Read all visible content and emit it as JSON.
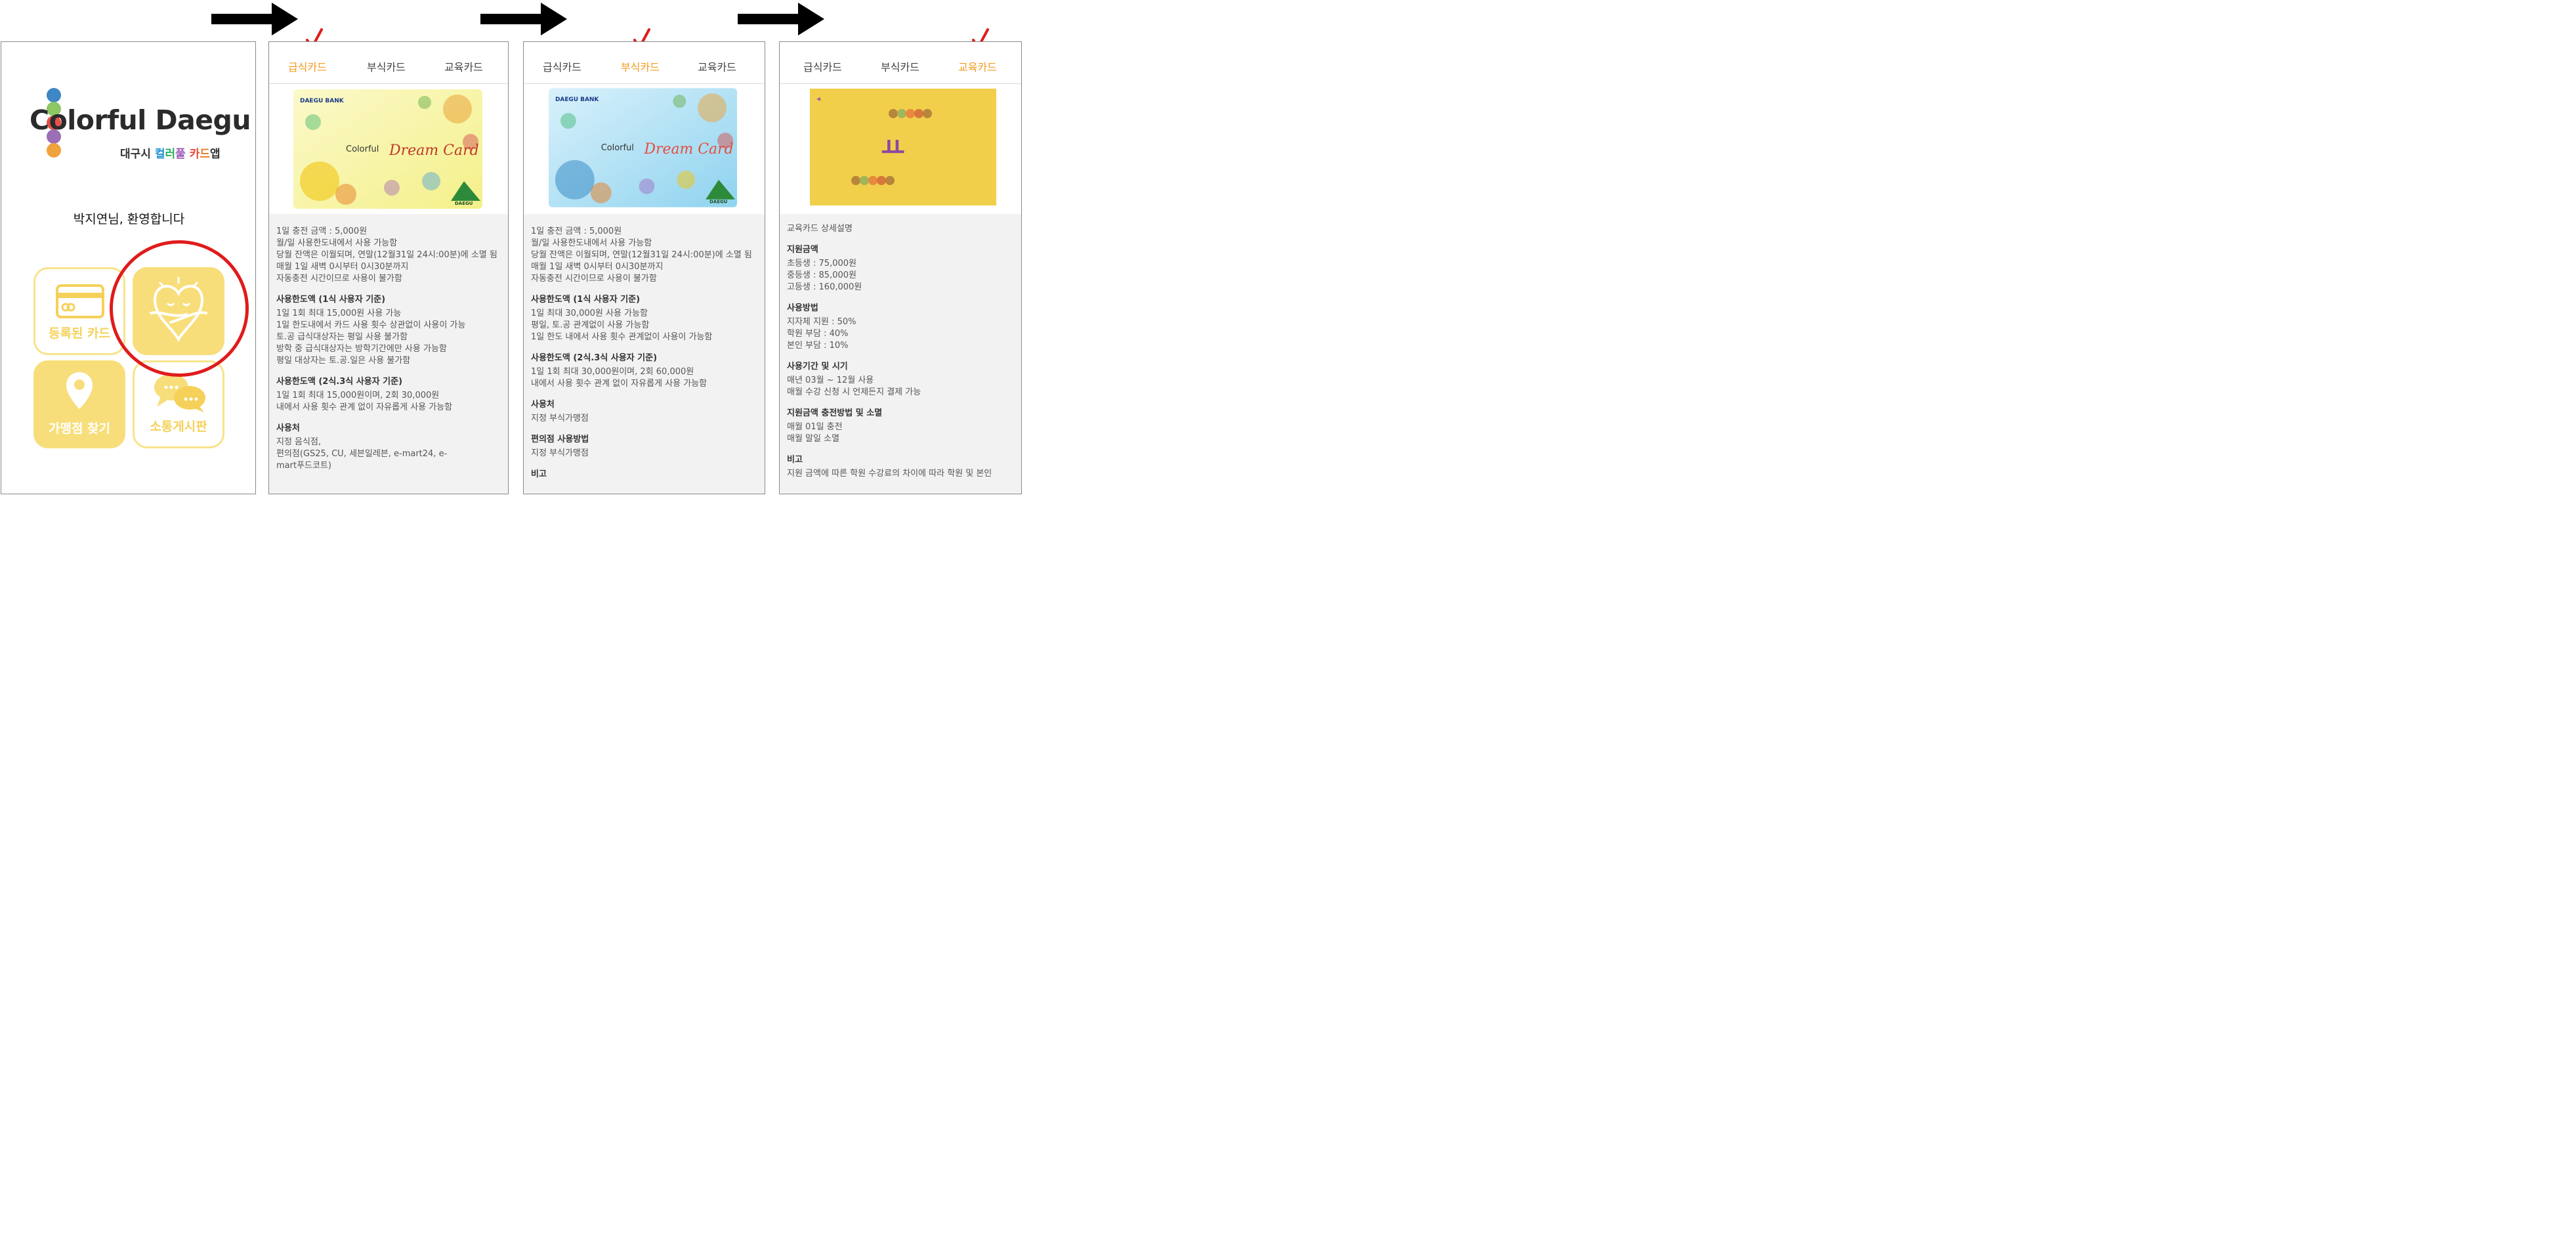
{
  "colors": {
    "accent": "#f39a1e",
    "tile_yellow": "#f8de7a",
    "highlight_red": "#e01b1b",
    "check_red": "#e01b1b"
  },
  "home": {
    "logo_text": "Colorful Daegu",
    "logo_sub": {
      "p1": "대구시 ",
      "p2": "컬",
      "p3": "러",
      "p4": "풀 ",
      "p5": "카",
      "p6": "드",
      "p7": "앱"
    },
    "welcome": "박지연님, 환영합니다",
    "tiles": {
      "registered_card": "등록된 카드",
      "card_info": "",
      "store_finder": "가맹점 찾기",
      "board": "소통게시판"
    }
  },
  "tabs": [
    "급식카드",
    "부식카드",
    "교육카드"
  ],
  "screens": {
    "meal": {
      "card": {
        "bank": "DAEGU BANK",
        "brand": "Colorful",
        "title": "Dream Card",
        "corner": "DAEGU"
      },
      "sections": [
        {
          "heading": "",
          "body": "1일 충전 금액 : 5,000원\n월/일 사용한도내에서 사용 가능함\n당월 잔액은 이월되며, 연말(12월31일 24시:00분)에 소멸 됨\n매월 1일 새벽 0시부터 0시30분까지\n자동충전 시간이므로 사용이 불가함"
        },
        {
          "heading": "사용한도액 (1식 사용자 기준)",
          "body": "1일 1회 최대 15,000원 사용 가능\n1일 한도내에서 카드 사용 횟수 상관없이 사용이 가능\n토.공 급식대상자는 평일 사용 불가함\n방학 중 급식대상자는 방학기간에만 사용 가능함\n평일 대상자는 토.공.일은 사용 불가함"
        },
        {
          "heading": "사용한도액 (2식.3식 사용자 기준)",
          "body": "1일 1회 최대 15,000원이며, 2회 30,000원\n내에서 사용 횟수 관계 없이 자유롭게 사용 가능함"
        },
        {
          "heading": "사용처",
          "body": "지정 음식점,\n편의점(GS25, CU, 세븐일레븐, e-mart24, e-\nmart푸드코트)"
        }
      ]
    },
    "side": {
      "card": {
        "bank": "DAEGU BANK",
        "brand": "Colorful",
        "title": "Dream Card",
        "corner": "DAEGU"
      },
      "sections": [
        {
          "heading": "",
          "body": "1일 충전 금액 : 5,000원\n월/일 사용한도내에서 사용 가능함\n당월 잔액은 이월되며, 연말(12월31일 24시:00분)에 소멸 됨\n매월 1일 새벽 0시부터 0시30분까지\n자동충전 시간이므로 사용이 불가함"
        },
        {
          "heading": "사용한도액 (1식 사용자 기준)",
          "body": "1일 최대 30,000원 사용 가능함\n평일, 토.공 관계없이 사용 가능함\n1일 한도 내에서 사용 횟수 관계없이 사용이 가능함"
        },
        {
          "heading": "사용한도액 (2식.3식 사용자 기준)",
          "body": "1일 1회 최대 30,000원이며, 2회 60,000원\n내에서 사용 횟수 관계 없이 자유롭게 사용 가능함"
        },
        {
          "heading": "사용처",
          "body": "지정 부식가맹점"
        },
        {
          "heading": "편의점 사용방법",
          "body": "지정 부식가맹점"
        },
        {
          "heading": "비고",
          "body": ""
        }
      ]
    },
    "edu": {
      "card": {
        "glyph": "ㅛ"
      },
      "sections": [
        {
          "heading": "",
          "body": "교육카드 상세설명"
        },
        {
          "heading": "지원금액",
          "body": "초등생 : 75,000원\n중등생 : 85,000원\n고등생 : 160,000원"
        },
        {
          "heading": "사용방법",
          "body": "지자체 지원 : 50%\n학원 부담 : 40%\n본인 부담 : 10%"
        },
        {
          "heading": "사용기간 및 시기",
          "body": "매년 03월 ~ 12월 사용\n매월 수강 신청 시 언제든지 결제 가능"
        },
        {
          "heading": "지원금액 충전방법 및 소멸",
          "body": "매월 01일 충전\n매월 말일 소멸"
        },
        {
          "heading": "비고",
          "body": "지원 금액에 따른 학원 수강료의 차이에 따라 학원 및 본인"
        }
      ]
    }
  }
}
